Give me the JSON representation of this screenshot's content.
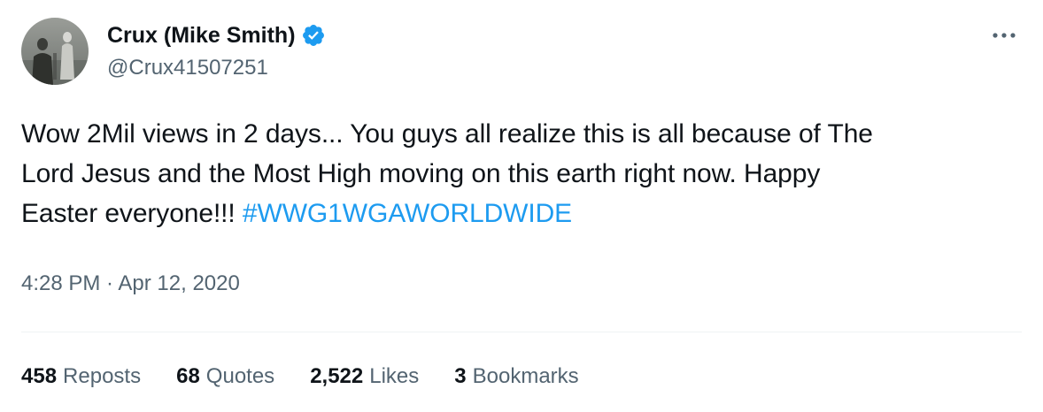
{
  "author": {
    "display_name": "Crux (Mike Smith)",
    "handle": "@Crux41507251",
    "verified": true
  },
  "tweet": {
    "text_lines": [
      "Wow 2Mil views in 2 days... You guys all realize this is all because of The",
      "Lord Jesus and the Most High moving on this earth right now.  Happy",
      "Easter everyone!!! "
    ],
    "hashtag": "#WWG1WGAWORLDWIDE"
  },
  "meta": {
    "time": "4:28 PM",
    "separator": " · ",
    "date": "Apr 12, 2020"
  },
  "stats": {
    "reposts": {
      "count": "458",
      "label": "Reposts"
    },
    "quotes": {
      "count": "68",
      "label": "Quotes"
    },
    "likes": {
      "count": "2,522",
      "label": "Likes"
    },
    "bookmarks": {
      "count": "3",
      "label": "Bookmarks"
    }
  },
  "icons": {
    "verified": "verified-badge-icon",
    "more": "more-options-icon"
  },
  "colors": {
    "text_primary": "#0f1419",
    "text_secondary": "#536471",
    "link": "#1d9bf0",
    "verified": "#1d9bf0",
    "divider": "#eff3f4"
  }
}
